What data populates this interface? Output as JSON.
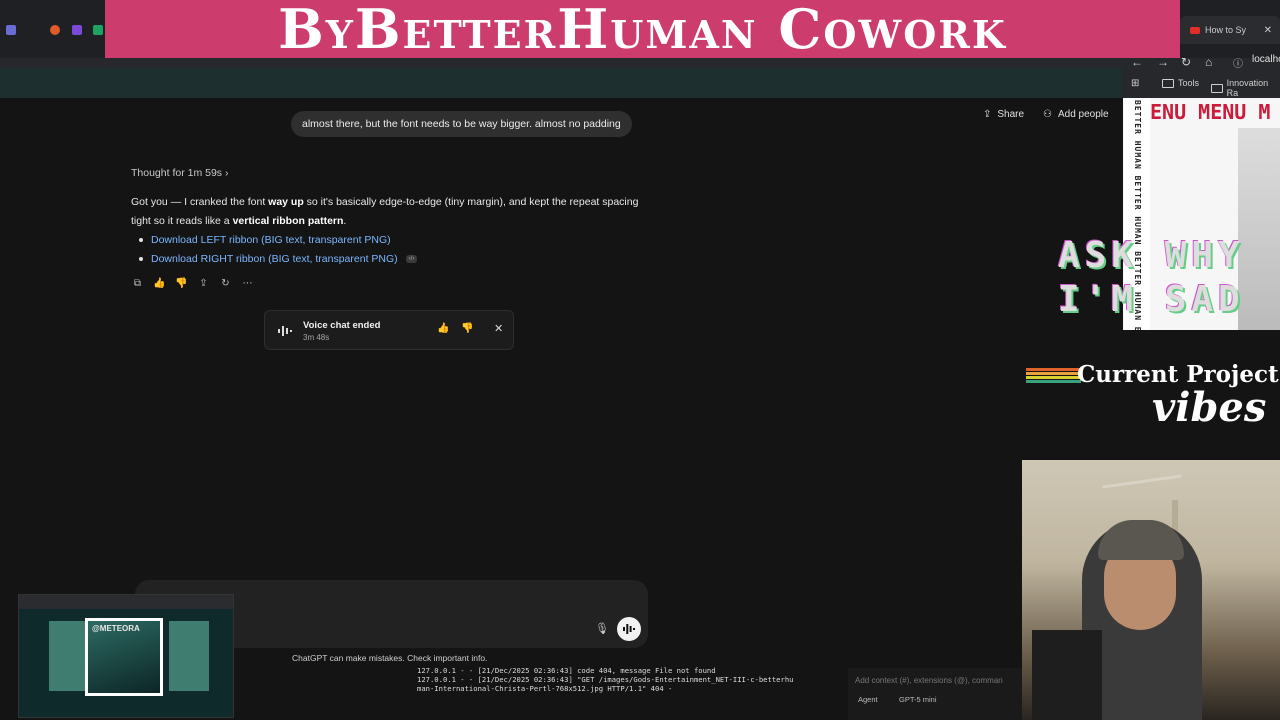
{
  "banner": {
    "title": "ByBetterHuman Cowork"
  },
  "browser": {
    "right_tab_title": "How to Sy",
    "url": "localho",
    "bookmarks": [
      {
        "label": "Tools"
      },
      {
        "label": "Innovation Ra"
      }
    ]
  },
  "chat": {
    "user_message": "almost there, but the font needs to be way bigger. almost no padding",
    "header_actions": {
      "share": "Share",
      "add_people": "Add people"
    },
    "thought": "Thought for 1m 59s",
    "reply": {
      "p1": "Got you — I cranked the font ",
      "b1": "way up",
      "p2": " so it's basically edge-to-edge (tiny margin), and kept the repeat spacing tight so it reads like a ",
      "b2": "vertical ribbon pattern",
      "p3": "."
    },
    "downloads": [
      {
        "label": "Download LEFT ribbon (BIG text, transparent PNG)"
      },
      {
        "label": "Download RIGHT ribbon (BIG text, transparent PNG)"
      }
    ],
    "voice": {
      "title": "Voice chat ended",
      "duration": "3m 48s"
    },
    "disclaimer": "ChatGPT can make mistakes. Check important info."
  },
  "terminal": {
    "lines": [
      "127.0.0.1 - - [21/Dec/2025 02:36:43] code 404, message File not found",
      "127.0.0.1 - - [21/Dec/2025 02:36:43] \"GET /images/Gods-Entertainment_NET-III-c-betterhu",
      "man-International-Christa-Pertl-768x512.jpg HTTP/1.1\" 404 -"
    ]
  },
  "agent_panel": {
    "placeholder": "Add context (#), extensions (@), comman",
    "agent_label": "Agent",
    "model_label": "GPT-5 mini"
  },
  "overlay": {
    "mini_screen_label": "@METEORA",
    "ribbon_vertical_text": "BETTER HUMAN BETTER HUMAN BETTER HUMAN BETTER",
    "menu_text": "ENU MENU M",
    "ask_text": "ASK WHY\nI'M SAD",
    "project_line1": "Current Project",
    "project_line2": "vibes"
  },
  "colors": {
    "banner": "#cc3d6e",
    "link": "#7ab7ff",
    "background": "#141414"
  }
}
